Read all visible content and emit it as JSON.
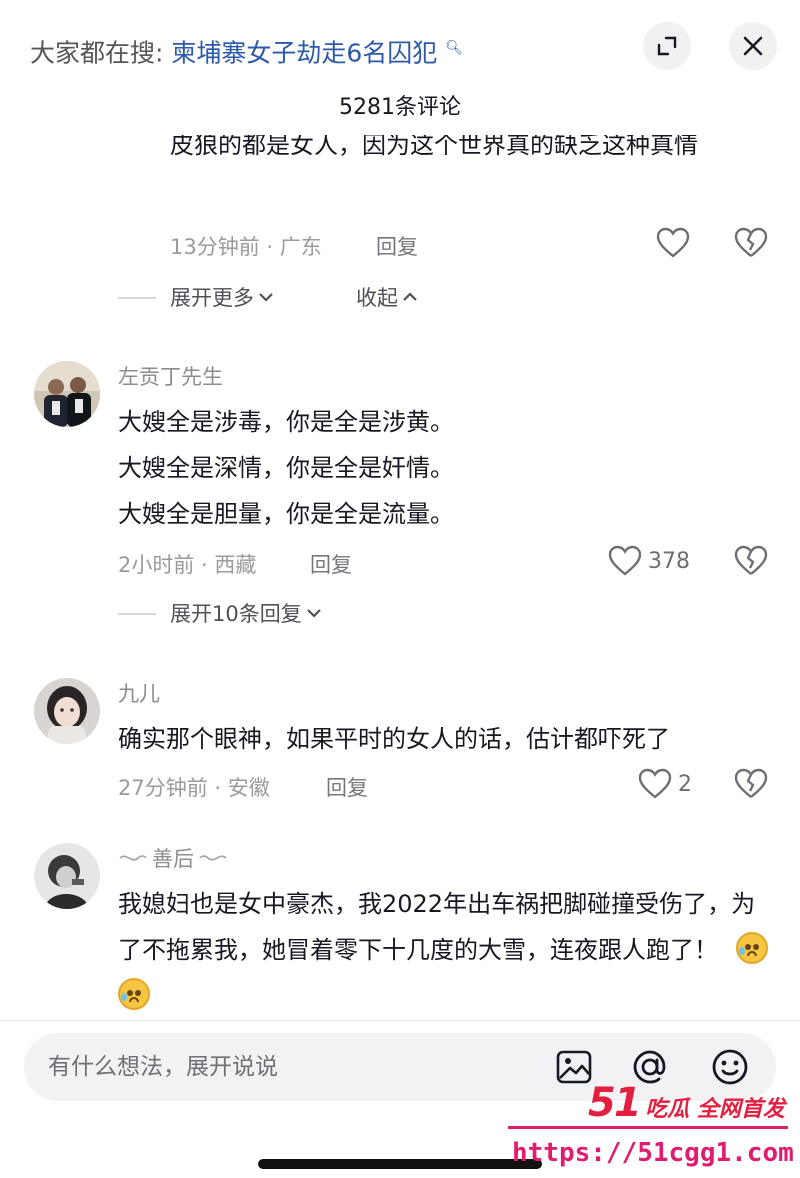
{
  "header": {
    "search_prefix": "大家都在搜:",
    "search_topic": "柬埔寨女子劫走6名囚犯",
    "comment_count": "5281条评论",
    "expand_icon": "expand-icon",
    "close_icon": "close-icon"
  },
  "prev_comment": {
    "text_cut": "皮狼的都是女人，因为这个世界真的缺乏这种真情",
    "meta": "13分钟前 · 广东",
    "reply_label": "回复",
    "expand_more": "展开更多",
    "collapse": "收起"
  },
  "comments": [
    {
      "username": "左贡丁先生",
      "lines": [
        "大嫂全是涉毒，你是全是涉黄。",
        "大嫂全是深情，你是全是奸情。",
        "大嫂全是胆量，你是全是流量。"
      ],
      "meta": "2小时前 · 西藏",
      "reply_label": "回复",
      "likes": "378",
      "expand_replies": "展开10条回复"
    },
    {
      "username": "九儿",
      "lines": [
        "确实那个眼神，如果平时的女人的话，估计都吓死了"
      ],
      "meta": "27分钟前 · 安徽",
      "reply_label": "回复",
      "likes": "2"
    },
    {
      "username": "善后",
      "username_decor": "⸜",
      "text": "我媳妇也是女中豪杰，我2022年出车祸把脚碰撞受伤了，为了不拖累我，她冒着零下十几度的大雪，连夜跟人跑了！"
    }
  ],
  "input": {
    "placeholder": "有什么想法，展开说说",
    "icons": [
      "image-icon",
      "at-icon",
      "emoji-icon"
    ]
  },
  "watermark": {
    "logo_num": "51",
    "logo_text": "吃瓜 全网首发",
    "url": "https://51cgg1.com"
  }
}
